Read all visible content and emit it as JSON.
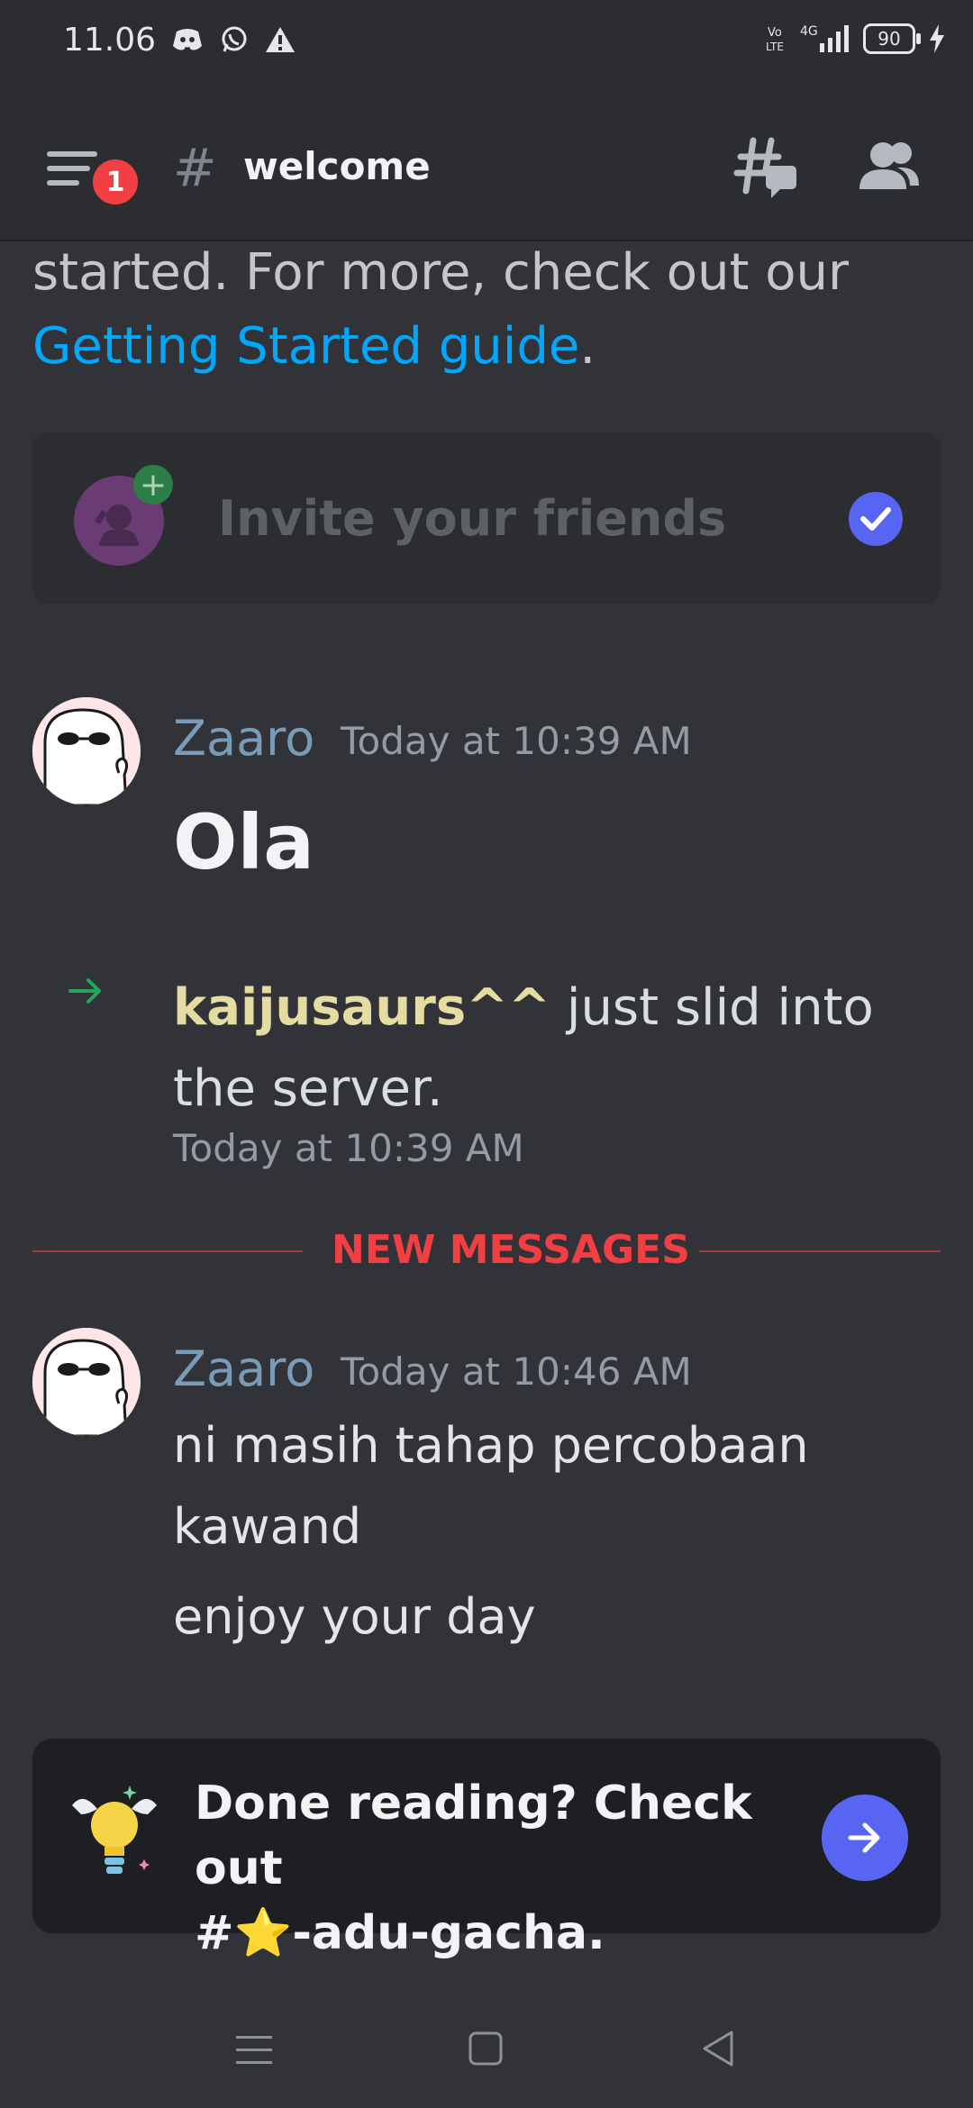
{
  "status_bar": {
    "time": "11.06",
    "battery": "90",
    "network": "4G"
  },
  "header": {
    "badge_count": "1",
    "hash": "#",
    "channel_name": "welcome"
  },
  "intro": {
    "text": "started. For more, check out our ",
    "link": "Getting Started guide",
    "period": "."
  },
  "invite": {
    "label": "Invite your friends"
  },
  "messages": [
    {
      "author": "Zaaro",
      "timestamp": "Today at 10:39 AM",
      "text": "Ola"
    },
    {
      "author": "Zaaro",
      "timestamp": "Today at 10:46 AM",
      "lines": [
        "ni masih tahap percobaan kawand",
        "enjoy your day"
      ]
    }
  ],
  "join": {
    "name": "kaijusaurs^^",
    "text": " just slid into the server.",
    "timestamp": "Today at 10:39 AM"
  },
  "divider": {
    "label": "NEW MESSAGES"
  },
  "done_card": {
    "line1": "Done reading? Check out",
    "line2": "#⭐-adu-gacha."
  },
  "colors": {
    "background": "#313338",
    "link": "#00a8fc",
    "accent": "#5865f2",
    "danger": "#f23f43",
    "author": "#7a9bb7",
    "join_name": "#e5dca1"
  }
}
